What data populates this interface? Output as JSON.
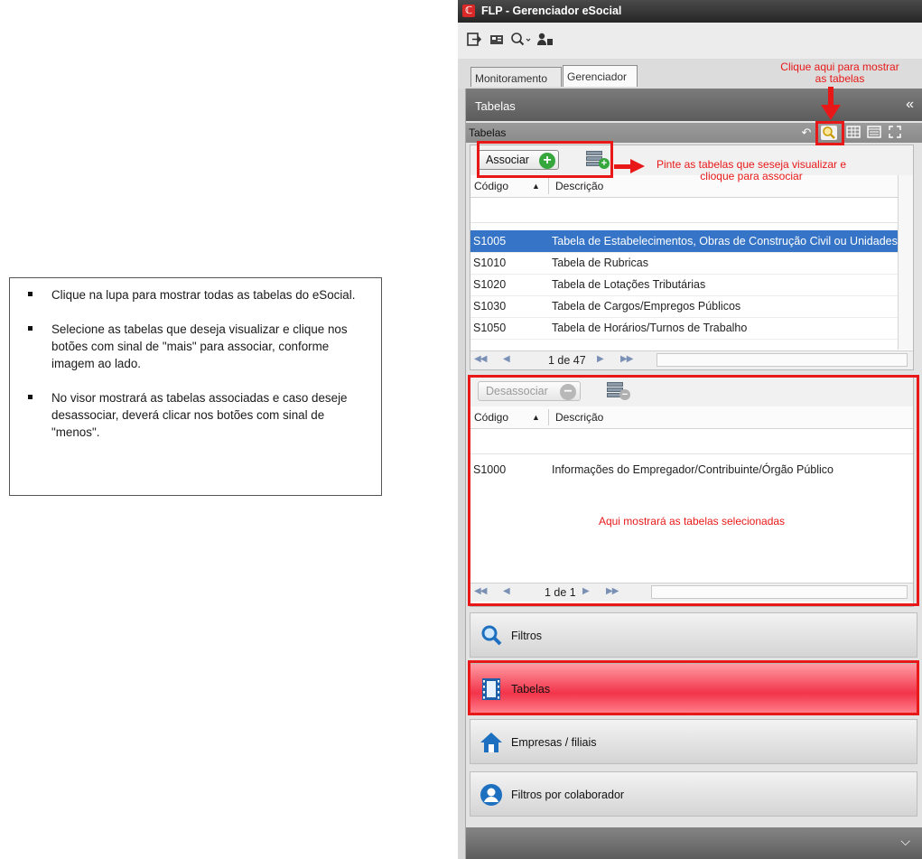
{
  "instructions": [
    "Clique na lupa para mostrar todas as tabelas do eSocial.",
    "Selecione as tabelas que deseja visualizar e clique nos botões com sinal de \"mais\" para associar, conforme imagem ao lado.",
    "No visor mostrará as tabelas associadas e caso deseje desassociar, deverá clicar nos botões com sinal de \"menos\"."
  ],
  "window": {
    "title": "FLP - Gerenciador eSocial"
  },
  "tabs": [
    {
      "label": "Monitoramento"
    },
    {
      "label": "Gerenciador"
    }
  ],
  "panel": {
    "title": "Tabelas",
    "subtitle": "Tabelas"
  },
  "available": {
    "button_label": "Associar",
    "columns": {
      "code": "Código",
      "description": "Descrição"
    },
    "rows": [
      {
        "code": "S1005",
        "desc": "Tabela de Estabelecimentos, Obras de Construção Civil ou Unidades"
      },
      {
        "code": "S1010",
        "desc": "Tabela de Rubricas"
      },
      {
        "code": "S1020",
        "desc": "Tabela de Lotações Tributárias"
      },
      {
        "code": "S1030",
        "desc": "Tabela de Cargos/Empregos Públicos"
      },
      {
        "code": "S1050",
        "desc": "Tabela de Horários/Turnos de Trabalho"
      }
    ],
    "pager": "1 de 47"
  },
  "associated": {
    "button_label": "Desassociar",
    "columns": {
      "code": "Código",
      "description": "Descrição"
    },
    "rows": [
      {
        "code": "S1000",
        "desc": "Informações do Empregador/Contribuinte/Órgão Público"
      }
    ],
    "pager": "1 de 1"
  },
  "nav": [
    {
      "label": "Filtros",
      "icon": "magnifier-icon"
    },
    {
      "label": "Tabelas",
      "icon": "film-icon"
    },
    {
      "label": "Empresas / filiais",
      "icon": "home-icon"
    },
    {
      "label": "Filtros por colaborador",
      "icon": "user-icon"
    }
  ],
  "annotations": {
    "search_hint": "Clique aqui para mostrar as tabelas",
    "associate_hint": "Pinte as tabelas que seseja visualizar e clioque para associar",
    "selected_hint": "Aqui mostrará as tabelas selecionadas"
  },
  "colors": {
    "annotation": "#e81818",
    "selection": "#3574c6",
    "active_nav": "#f2344a"
  }
}
